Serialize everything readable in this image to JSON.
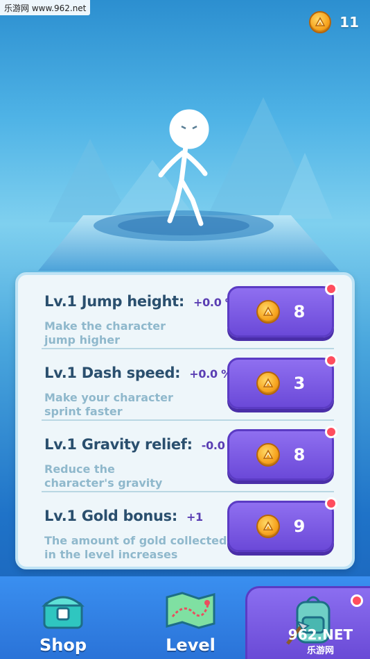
{
  "watermark_top": "乐游网 www.962.net",
  "hud": {
    "coins": "11",
    "coin_icon": "gold-coin"
  },
  "upgrades": [
    {
      "level": "Lv.1",
      "name": "Jump height:",
      "value": "+0.0 %",
      "desc1": "Make the character",
      "desc2": "jump higher",
      "price": "8"
    },
    {
      "level": "Lv.1",
      "name": "Dash speed:",
      "value": "+0.0 %",
      "desc1": "Make your character",
      "desc2": "sprint faster",
      "price": "3"
    },
    {
      "level": "Lv.1",
      "name": "Gravity relief:",
      "value": "-0.0 %",
      "desc1": "Reduce the",
      "desc2": "character's gravity",
      "price": "8"
    },
    {
      "level": "Lv.1",
      "name": "Gold bonus:",
      "value": "+1",
      "desc1": "The amount of gold collected",
      "desc2": "in the level increases",
      "price": "9"
    }
  ],
  "nav": {
    "shop": "Shop",
    "level": "Level"
  },
  "watermark_bottom": {
    "line1": "962.NET",
    "line2": "乐游网"
  },
  "colors": {
    "accent_purple": "#6b49d8",
    "coin_gold": "#f6a21d",
    "notify_red": "#ff4d5e"
  }
}
